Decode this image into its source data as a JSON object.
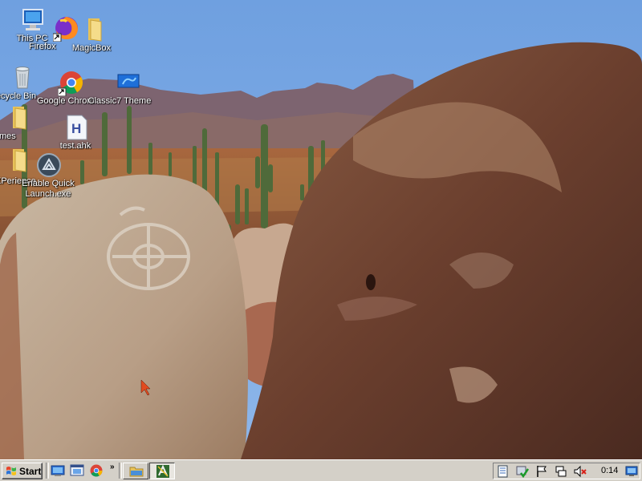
{
  "desktop": {
    "icons": [
      {
        "label": "This PC",
        "icon": "computer-icon"
      },
      {
        "label": "Firefox",
        "icon": "firefox-icon"
      },
      {
        "label": "MagicBox",
        "icon": "folder-icon"
      },
      {
        "label": "Recycle Bin",
        "icon": "recycle-bin-icon"
      },
      {
        "label": "Google Chrome",
        "icon": "chrome-icon"
      },
      {
        "label": "Classic7 Theme",
        "icon": "theme-icon"
      },
      {
        "label": "Themes",
        "icon": "folder-icon"
      },
      {
        "label": "test.ahk",
        "icon": "ahk-script-icon"
      },
      {
        "label": "XPerience",
        "icon": "folder-icon"
      },
      {
        "label": "Enable Quick\nLaunch.exe",
        "icon": "quick-launch-exe-icon"
      }
    ]
  },
  "taskbar": {
    "start_label": "Start",
    "quick_launch": [
      "show-desktop-icon",
      "ie-window-icon",
      "chrome-icon"
    ],
    "overflow_chevron": "»",
    "tasks": [
      {
        "name": "explorer-folder-task",
        "active": false
      },
      {
        "name": "autohotkey-window-task",
        "active": true
      }
    ],
    "tray_icons": [
      "notepad-tray-icon",
      "security-check-icon",
      "flag-icon",
      "network-icon",
      "volume-muted-icon"
    ],
    "clock": "0:14",
    "show_desktop_icon": "display-icon"
  },
  "colors": {
    "taskbar": "#d4d0c8",
    "sky": "#7aa7e3"
  }
}
